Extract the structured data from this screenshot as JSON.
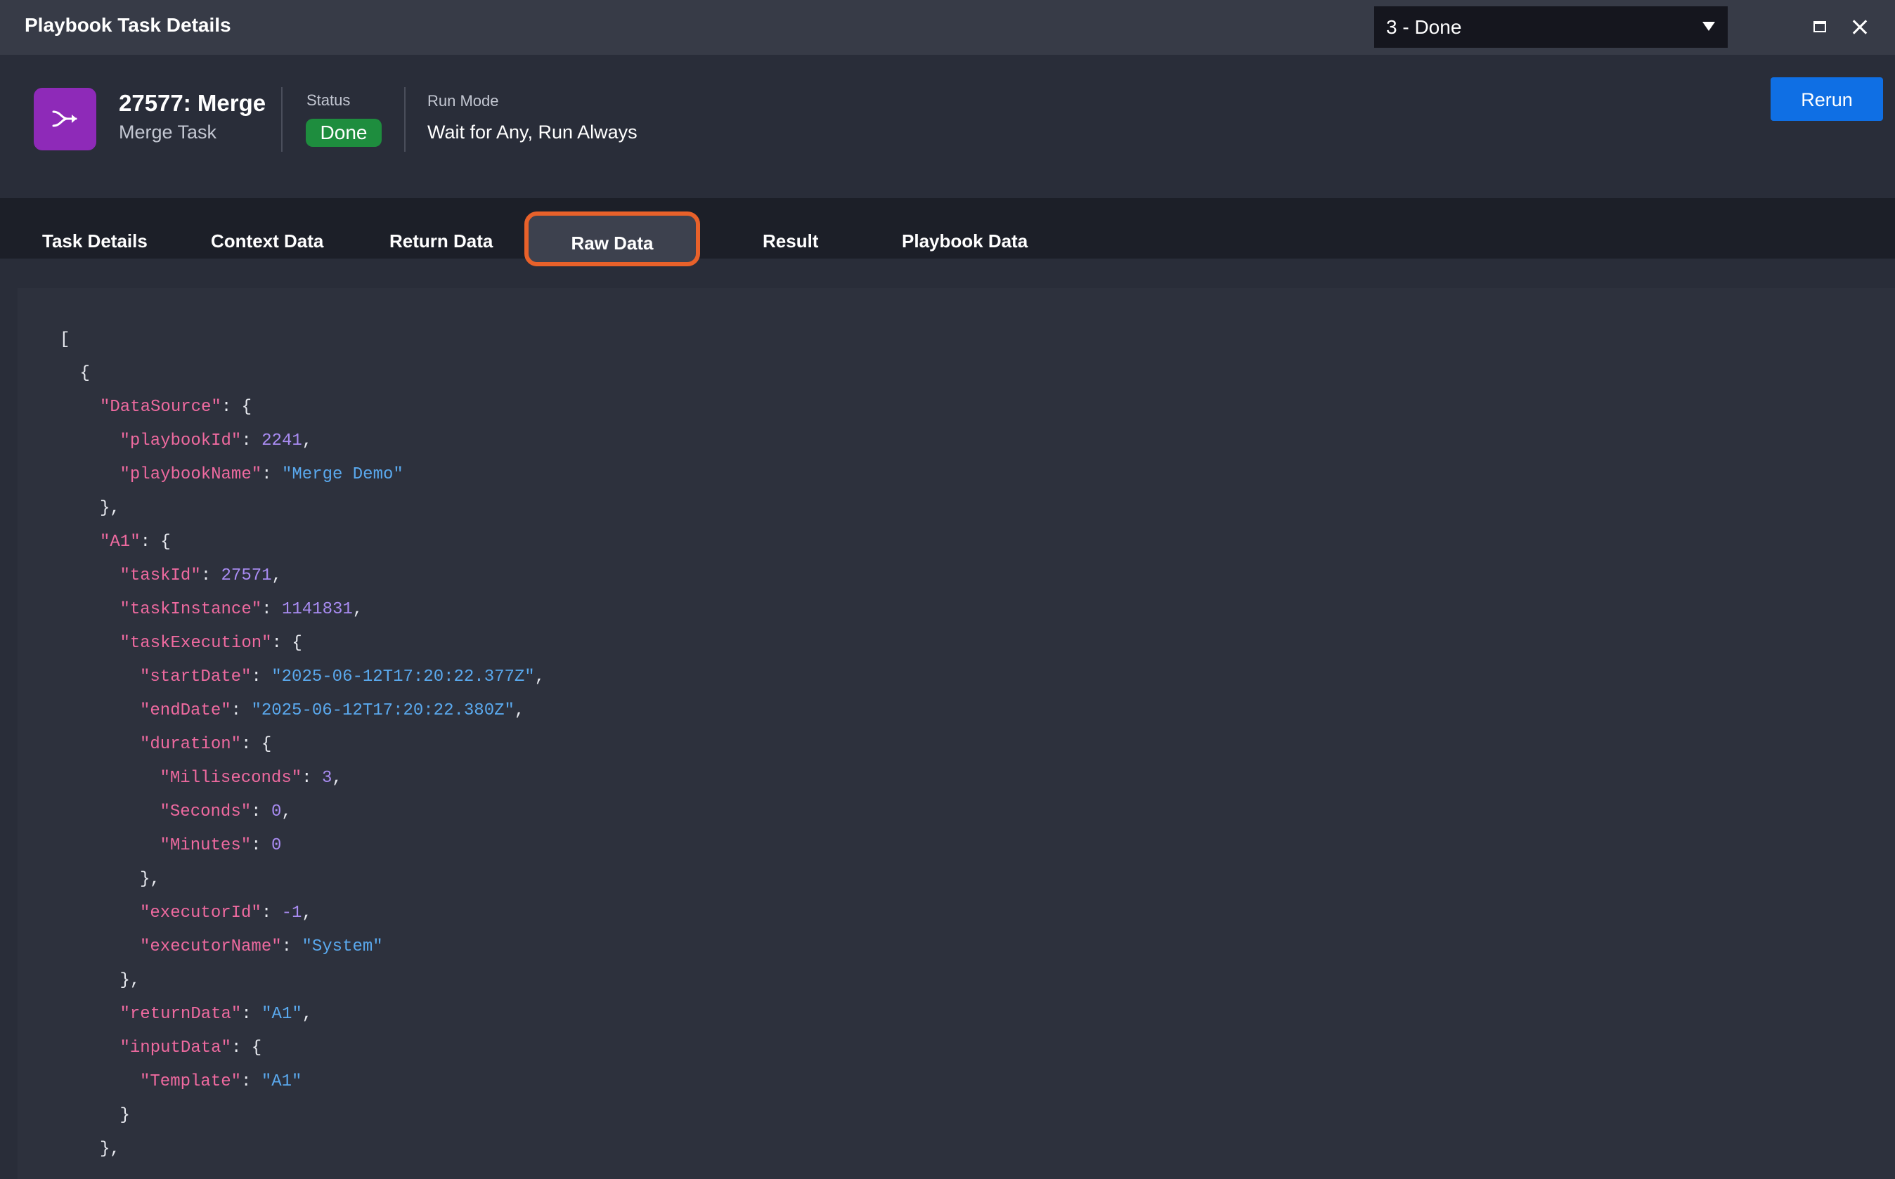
{
  "window": {
    "title": "Playbook Task Details",
    "state_select_value": "3 - Done",
    "maximize_icon": "maximize-icon",
    "close_icon": "close-icon"
  },
  "header": {
    "icon": "merge-icon",
    "icon_color": "#8e2ab8",
    "task_name": "27577: Merge",
    "task_type": "Merge Task",
    "status_label": "Status",
    "status_value": "Done",
    "status_color": "#1e8d3e",
    "run_mode_label": "Run Mode",
    "run_mode_value": "Wait for Any, Run Always",
    "rerun_label": "Rerun",
    "accent_color": "#0f6fe4"
  },
  "tabs": [
    {
      "label": "Task Details",
      "active": false
    },
    {
      "label": "Context Data",
      "active": false
    },
    {
      "label": "Return Data",
      "active": false
    },
    {
      "label": "Raw Data",
      "active": true
    },
    {
      "label": "Result",
      "active": false
    },
    {
      "label": "Playbook Data",
      "active": false
    }
  ],
  "highlight_color": "#e8612a",
  "raw_data": {
    "lines": [
      {
        "indent": 0,
        "tokens": [
          {
            "t": "[",
            "c": "p"
          }
        ]
      },
      {
        "indent": 1,
        "tokens": [
          {
            "t": "{",
            "c": "p"
          }
        ]
      },
      {
        "indent": 2,
        "tokens": [
          {
            "t": "\"DataSource\"",
            "c": "k"
          },
          {
            "t": ": {",
            "c": "p"
          }
        ]
      },
      {
        "indent": 3,
        "tokens": [
          {
            "t": "\"playbookId\"",
            "c": "k"
          },
          {
            "t": ": ",
            "c": "p"
          },
          {
            "t": "2241",
            "c": "n"
          },
          {
            "t": ",",
            "c": "p"
          }
        ]
      },
      {
        "indent": 3,
        "tokens": [
          {
            "t": "\"playbookName\"",
            "c": "k"
          },
          {
            "t": ": ",
            "c": "p"
          },
          {
            "t": "\"Merge Demo\"",
            "c": "s"
          }
        ]
      },
      {
        "indent": 2,
        "tokens": [
          {
            "t": "},",
            "c": "p"
          }
        ]
      },
      {
        "indent": 2,
        "tokens": [
          {
            "t": "\"A1\"",
            "c": "k"
          },
          {
            "t": ": {",
            "c": "p"
          }
        ]
      },
      {
        "indent": 3,
        "tokens": [
          {
            "t": "\"taskId\"",
            "c": "k"
          },
          {
            "t": ": ",
            "c": "p"
          },
          {
            "t": "27571",
            "c": "n"
          },
          {
            "t": ",",
            "c": "p"
          }
        ]
      },
      {
        "indent": 3,
        "tokens": [
          {
            "t": "\"taskInstance\"",
            "c": "k"
          },
          {
            "t": ": ",
            "c": "p"
          },
          {
            "t": "1141831",
            "c": "n"
          },
          {
            "t": ",",
            "c": "p"
          }
        ]
      },
      {
        "indent": 3,
        "tokens": [
          {
            "t": "\"taskExecution\"",
            "c": "k"
          },
          {
            "t": ": {",
            "c": "p"
          }
        ]
      },
      {
        "indent": 4,
        "tokens": [
          {
            "t": "\"startDate\"",
            "c": "k"
          },
          {
            "t": ": ",
            "c": "p"
          },
          {
            "t": "\"2025-06-12T17:20:22.377Z\"",
            "c": "s"
          },
          {
            "t": ",",
            "c": "p"
          }
        ]
      },
      {
        "indent": 4,
        "tokens": [
          {
            "t": "\"endDate\"",
            "c": "k"
          },
          {
            "t": ": ",
            "c": "p"
          },
          {
            "t": "\"2025-06-12T17:20:22.380Z\"",
            "c": "s"
          },
          {
            "t": ",",
            "c": "p"
          }
        ]
      },
      {
        "indent": 4,
        "tokens": [
          {
            "t": "\"duration\"",
            "c": "k"
          },
          {
            "t": ": {",
            "c": "p"
          }
        ]
      },
      {
        "indent": 5,
        "tokens": [
          {
            "t": "\"Milliseconds\"",
            "c": "k"
          },
          {
            "t": ": ",
            "c": "p"
          },
          {
            "t": "3",
            "c": "n"
          },
          {
            "t": ",",
            "c": "p"
          }
        ]
      },
      {
        "indent": 5,
        "tokens": [
          {
            "t": "\"Seconds\"",
            "c": "k"
          },
          {
            "t": ": ",
            "c": "p"
          },
          {
            "t": "0",
            "c": "n"
          },
          {
            "t": ",",
            "c": "p"
          }
        ]
      },
      {
        "indent": 5,
        "tokens": [
          {
            "t": "\"Minutes\"",
            "c": "k"
          },
          {
            "t": ": ",
            "c": "p"
          },
          {
            "t": "0",
            "c": "n"
          }
        ]
      },
      {
        "indent": 4,
        "tokens": [
          {
            "t": "},",
            "c": "p"
          }
        ]
      },
      {
        "indent": 4,
        "tokens": [
          {
            "t": "\"executorId\"",
            "c": "k"
          },
          {
            "t": ": ",
            "c": "p"
          },
          {
            "t": "-1",
            "c": "n"
          },
          {
            "t": ",",
            "c": "p"
          }
        ]
      },
      {
        "indent": 4,
        "tokens": [
          {
            "t": "\"executorName\"",
            "c": "k"
          },
          {
            "t": ": ",
            "c": "p"
          },
          {
            "t": "\"System\"",
            "c": "s"
          }
        ]
      },
      {
        "indent": 3,
        "tokens": [
          {
            "t": "},",
            "c": "p"
          }
        ]
      },
      {
        "indent": 3,
        "tokens": [
          {
            "t": "\"returnData\"",
            "c": "k"
          },
          {
            "t": ": ",
            "c": "p"
          },
          {
            "t": "\"A1\"",
            "c": "s"
          },
          {
            "t": ",",
            "c": "p"
          }
        ]
      },
      {
        "indent": 3,
        "tokens": [
          {
            "t": "\"inputData\"",
            "c": "k"
          },
          {
            "t": ": {",
            "c": "p"
          }
        ]
      },
      {
        "indent": 4,
        "tokens": [
          {
            "t": "\"Template\"",
            "c": "k"
          },
          {
            "t": ": ",
            "c": "p"
          },
          {
            "t": "\"A1\"",
            "c": "s"
          }
        ]
      },
      {
        "indent": 3,
        "tokens": [
          {
            "t": "}",
            "c": "p"
          }
        ]
      },
      {
        "indent": 2,
        "tokens": [
          {
            "t": "},",
            "c": "p"
          }
        ]
      }
    ]
  }
}
